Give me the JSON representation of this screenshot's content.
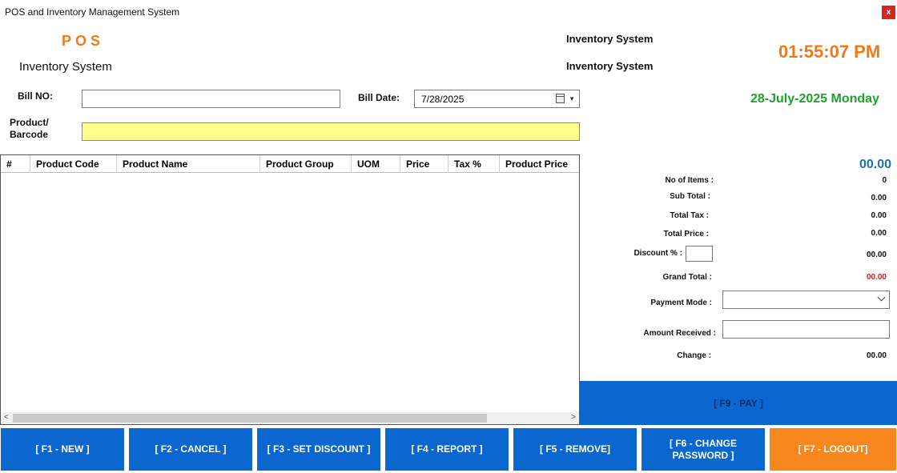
{
  "window": {
    "title": "POS and Inventory Management System",
    "close_label": "x"
  },
  "header": {
    "logo_text": "POS",
    "left_subtitle": "Inventory System",
    "center_line1": "Inventory System",
    "center_line2": "Inventory System",
    "time": "01:55:07 PM",
    "date": "28-July-2025 Monday"
  },
  "form": {
    "bill_no_label": "Bill NO:",
    "bill_no_value": "",
    "bill_date_label": "Bill Date:",
    "bill_date_value": "7/28/2025",
    "product_label_line1": "Product/",
    "product_label_line2": "Barcode",
    "product_value": ""
  },
  "grid": {
    "columns": [
      "#",
      "Product Code",
      "Product Name",
      "Product Group",
      "UOM",
      "Price",
      "Tax %",
      "Product Price"
    ],
    "rows": []
  },
  "summary": {
    "big_total": "00.00",
    "no_of_items_label": "No of Items :",
    "no_of_items_value": "0",
    "sub_total_label": "Sub Total :",
    "sub_total_value": "0.00",
    "total_tax_label": "Total Tax :",
    "total_tax_value": "0.00",
    "total_price_label": "Total Price :",
    "total_price_value": "0.00",
    "discount_label": "Discount % :",
    "discount_value": "00.00",
    "grand_total_label": "Grand Total :",
    "grand_total_value": "00.00",
    "payment_mode_label": "Payment Mode :",
    "payment_mode_value": "",
    "amount_received_label": "Amount Received :",
    "amount_received_value": "",
    "change_label": "Change :",
    "change_value": "00.00"
  },
  "actions": {
    "pay": "[ F9 - PAY ]",
    "new": "[ F1 - NEW ]",
    "cancel": "[ F2 - CANCEL ]",
    "set_discount": "[ F3 - SET DISCOUNT ]",
    "report": "[ F4 - REPORT ]",
    "remove": "[ F5 - REMOVE]",
    "change_password_line1": "[ F6 - CHANGE",
    "change_password_line2": "PASSWORD ]",
    "logout": "[ F7 - LOGOUT]"
  },
  "colors": {
    "accent_orange": "#f07a1a",
    "date_green": "#1fa12e",
    "button_blue": "#0c66cf",
    "grand_total_red": "#cc1f1f",
    "barcode_yellow": "#ffff8c"
  }
}
